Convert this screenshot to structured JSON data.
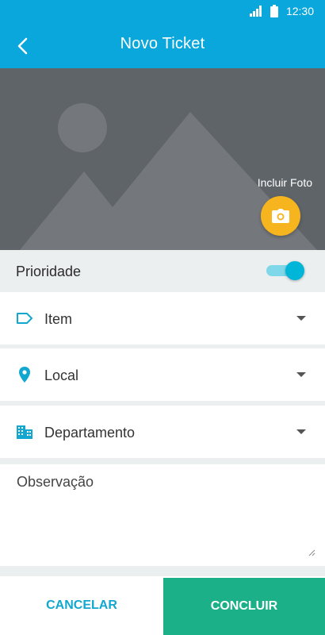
{
  "status_bar": {
    "time": "12:30",
    "icons": [
      "signal-icon",
      "battery-icon"
    ]
  },
  "app_bar": {
    "title": "Novo Ticket",
    "back_icon": "chevron-left-icon"
  },
  "photo": {
    "label": "Incluir Foto",
    "button_icon": "camera-icon",
    "placeholder_icon": "image-placeholder-icon"
  },
  "priority": {
    "label": "Prioridade",
    "toggle_on": true
  },
  "fields": [
    {
      "label": "Item",
      "icon": "tag-icon"
    },
    {
      "label": "Local",
      "icon": "location-pin-icon"
    },
    {
      "label": "Departamento",
      "icon": "building-icon"
    }
  ],
  "observation": {
    "placeholder": "Observação",
    "value": ""
  },
  "actions": {
    "cancel_label": "CANCELAR",
    "confirm_label": "CONCLUIR"
  },
  "colors": {
    "primary": "#0aa7dc",
    "accent": "#f6b51e",
    "toggle": "#00b6d8",
    "confirm": "#1bb088",
    "icon": "#11a7cf"
  }
}
